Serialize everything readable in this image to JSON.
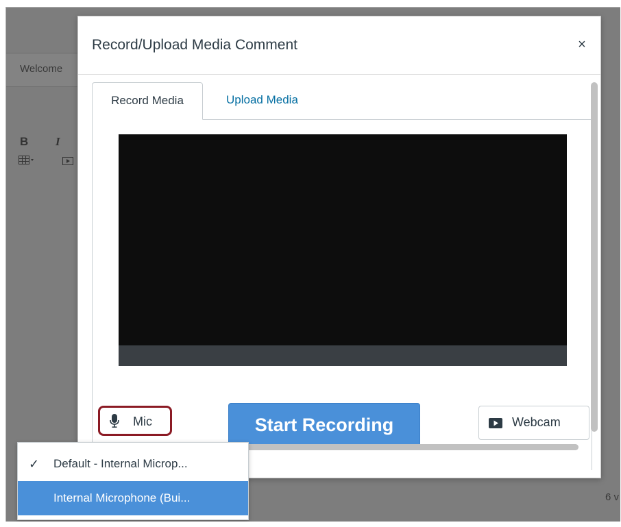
{
  "background": {
    "welcome_text": "Welcome",
    "bold_label": "B",
    "italic_label": "I",
    "word_count_fragment": "6 v"
  },
  "modal": {
    "title": "Record/Upload Media Comment",
    "close_label": "×",
    "tabs": [
      {
        "label": "Record Media",
        "active": true
      },
      {
        "label": "Upload Media",
        "active": false
      }
    ],
    "mic_label": "Mic",
    "start_label": "Start Recording",
    "webcam_label": "Webcam"
  },
  "mic_dropdown": {
    "options": [
      {
        "label": "Default - Internal Microp...",
        "selected": true
      },
      {
        "label": "Internal Microphone (Bui...",
        "selected": false,
        "highlighted": true
      }
    ]
  },
  "colors": {
    "accent": "#4a90d9",
    "link": "#0770a3",
    "mic_outline": "#8b1a24"
  }
}
